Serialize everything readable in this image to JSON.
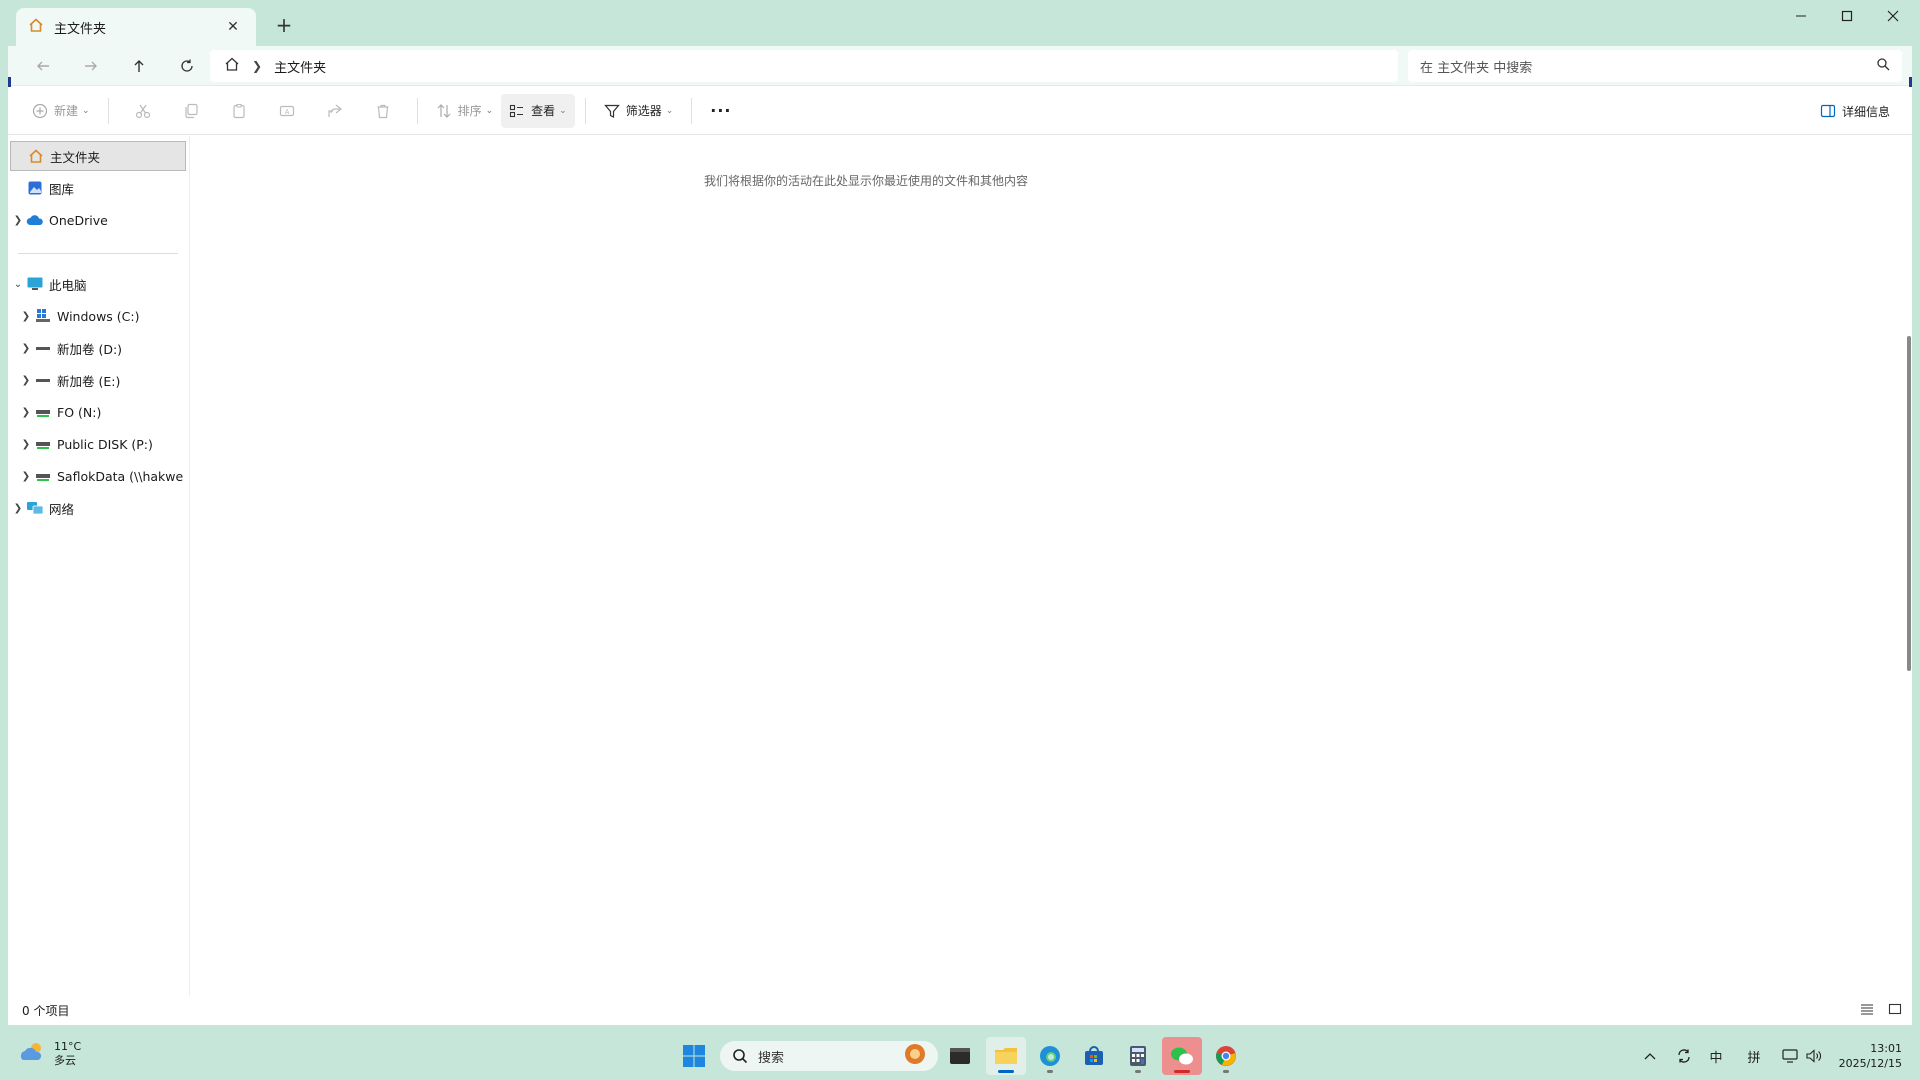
{
  "tab": {
    "title": "主文件夹"
  },
  "address": {
    "crumb": "主文件夹"
  },
  "search": {
    "placeholder": "在 主文件夹 中搜索"
  },
  "toolbar": {
    "new_label": "新建",
    "sort_label": "排序",
    "view_label": "查看",
    "filter_label": "筛选器",
    "more_label": "···",
    "details_label": "详细信息"
  },
  "sidebar": {
    "items": [
      {
        "label": "主文件夹",
        "icon": "home-icon"
      },
      {
        "label": "图库",
        "icon": "gallery-icon"
      },
      {
        "label": "OneDrive",
        "icon": "cloud-icon"
      },
      {
        "label": "此电脑",
        "icon": "computer-icon"
      },
      {
        "label": "Windows (C:)",
        "icon": "windows-drive-icon"
      },
      {
        "label": "新加卷 (D:)",
        "icon": "drive-icon"
      },
      {
        "label": "新加卷 (E:)",
        "icon": "drive-icon"
      },
      {
        "label": "FO (N:)",
        "icon": "network-drive-icon"
      },
      {
        "label": "Public DISK (P:)",
        "icon": "network-drive-icon"
      },
      {
        "label": "SaflokData (\\\\hakwe",
        "icon": "network-drive-icon"
      },
      {
        "label": "网络",
        "icon": "network-icon"
      }
    ]
  },
  "content": {
    "empty_message": "我们将根据你的活动在此处显示你最近使用的文件和其他内容"
  },
  "status": {
    "item_count": "0 个项目"
  },
  "taskbar": {
    "weather_temp": "11°C",
    "weather_desc": "多云",
    "search_label": "搜索",
    "ime_lang": "中",
    "ime_mode": "拼",
    "time": "13:01",
    "date": "2025/12/15"
  },
  "colors": {
    "accent": "#0067c0",
    "taskbar_bg": "#c6e6da",
    "edge_accent": "#1f3a8a"
  }
}
